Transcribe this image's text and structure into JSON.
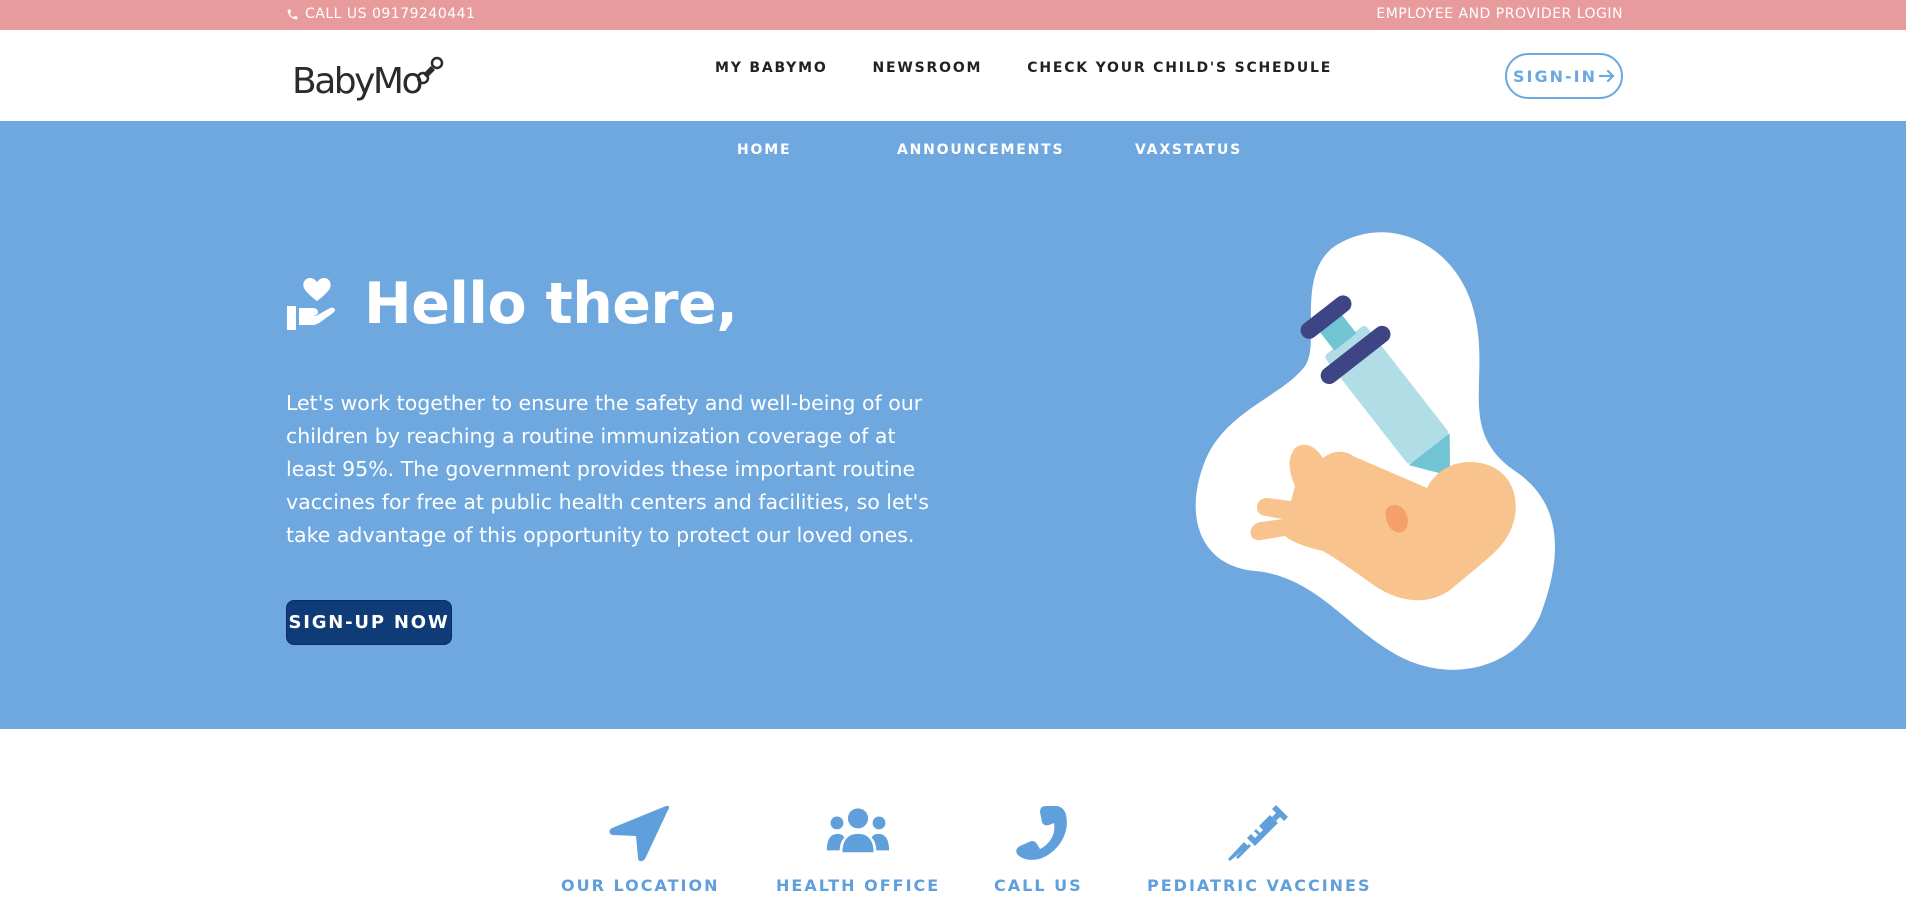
{
  "topbar": {
    "call_label": "CALL US 09179240441",
    "employee_login": "EMPLOYEE AND PROVIDER LOGIN"
  },
  "header": {
    "logo_text": "BabyMo",
    "nav": [
      "MY BABYMO",
      "NEWSROOM",
      "CHECK YOUR CHILD'S SCHEDULE"
    ],
    "signin_label": "SIGN-IN"
  },
  "subnav": [
    "HOME",
    "ANNOUNCEMENTS",
    "VAXSTATUS"
  ],
  "hero": {
    "title": "Hello there,",
    "text": "Let's work together to ensure the safety and well-being of our children by reaching a routine immunization coverage of at least 95%. The government provides these important routine vaccines for free at public health centers and facilities, so let's take advantage of this opportunity to protect our loved ones.",
    "cta": "SIGN-UP NOW"
  },
  "features": [
    {
      "label": "OUR LOCATION",
      "icon": "location-arrow-icon"
    },
    {
      "label": "HEALTH OFFICE",
      "icon": "people-group-icon"
    },
    {
      "label": "CALL US",
      "icon": "phone-icon"
    },
    {
      "label": "PEDIATRIC VACCINES",
      "icon": "syringe-icon"
    }
  ],
  "colors": {
    "topbar": "#e89b9c",
    "hero": "#6ea8df",
    "accent": "#5f9fdb",
    "cta": "#0f3c77"
  }
}
